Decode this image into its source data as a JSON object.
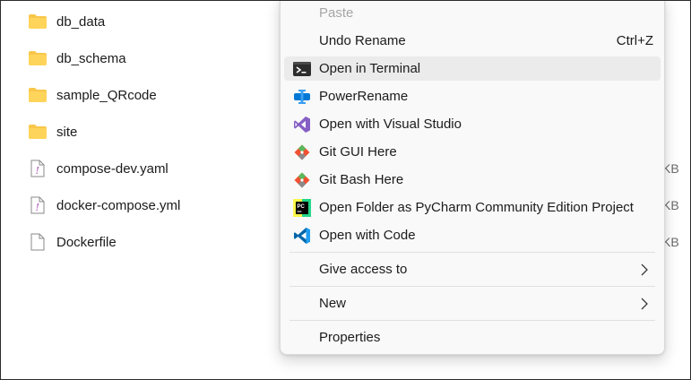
{
  "files": [
    {
      "name": "db_data",
      "type": "folder",
      "size": ""
    },
    {
      "name": "db_schema",
      "type": "folder",
      "size": ""
    },
    {
      "name": "sample_QRcode",
      "type": "folder",
      "size": ""
    },
    {
      "name": "site",
      "type": "folder",
      "size": ""
    },
    {
      "name": "compose-dev.yaml",
      "type": "yaml",
      "size": "KB"
    },
    {
      "name": "docker-compose.yml",
      "type": "yaml",
      "size": "KB"
    },
    {
      "name": "Dockerfile",
      "type": "file",
      "size": "KB"
    }
  ],
  "context_menu": {
    "items": [
      {
        "label": "Paste",
        "icon": "none",
        "disabled": true
      },
      {
        "label": "Undo Rename",
        "shortcut": "Ctrl+Z",
        "icon": "none"
      },
      {
        "label": "Open in Terminal",
        "icon": "terminal-icon",
        "hovered": true
      },
      {
        "label": "PowerRename",
        "icon": "powerrename-icon"
      },
      {
        "label": "Open with Visual Studio",
        "icon": "visual-studio-icon"
      },
      {
        "label": "Git GUI Here",
        "icon": "git-icon"
      },
      {
        "label": "Git Bash Here",
        "icon": "git-icon"
      },
      {
        "label": "Open Folder as PyCharm Community Edition Project",
        "icon": "pycharm-icon"
      },
      {
        "label": "Open with Code",
        "icon": "vscode-icon"
      },
      {
        "label": "Give access to",
        "icon": "none",
        "submenu": true
      },
      {
        "label": "New",
        "icon": "none",
        "submenu": true
      },
      {
        "label": "Properties",
        "icon": "none"
      }
    ]
  },
  "colors": {
    "folder": "#f8c74a",
    "hover": "#ebebeb",
    "accent_blue": "#0078d4",
    "visual_studio_purple": "#865fc5",
    "git_orange": "#f05133",
    "vscode_blue": "#0065a9"
  }
}
